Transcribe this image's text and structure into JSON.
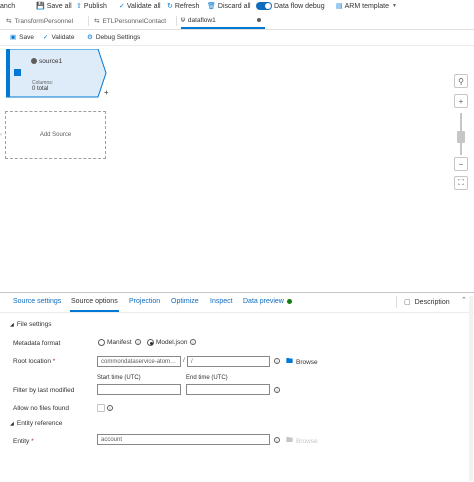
{
  "toolbar": {
    "branch_partial": "anch",
    "save_all": "Save all",
    "publish": "Publish",
    "validate_all": "Validate all",
    "refresh": "Refresh",
    "discard_all": "Discard all",
    "data_flow_debug": "Data flow debug",
    "arm_template": "ARM template"
  },
  "tabs": [
    {
      "label": "TransformPersonnel",
      "icon": "pipeline-icon"
    },
    {
      "label": "ETLPersonnelContact",
      "icon": "pipeline-icon"
    },
    {
      "label": "dataflow1",
      "icon": "dataflow-icon",
      "active": true
    }
  ],
  "subtoolbar": {
    "save": "Save",
    "validate": "Validate",
    "debug_settings": "Debug Settings"
  },
  "canvas": {
    "node": {
      "title": "source1",
      "columns_label": "Columns:",
      "columns_value": "0 total"
    },
    "add_source": "Add Source"
  },
  "panel": {
    "tabs": [
      "Source settings",
      "Source options",
      "Projection",
      "Optimize",
      "Inspect",
      "Data preview"
    ],
    "active_tab": "Source options",
    "data_preview_status_color": "#107c10",
    "description": "Description",
    "file_settings": {
      "heading": "File settings",
      "metadata_format_label": "Metadata format",
      "option_manifest": "Manifest",
      "option_model_json": "Model.json",
      "selected_option": "Model.json",
      "root_location_label": "Root location",
      "root_location_container": "commondataservice-atom…",
      "root_location_path": "/",
      "separator": "/",
      "browse": "Browse",
      "filter_label": "Filter by last modified",
      "start_time_label": "Start time (UTC)",
      "end_time_label": "End time (UTC)",
      "allow_no_files_label": "Allow no files found"
    },
    "entity_reference": {
      "heading": "Entity reference",
      "entity_label": "Entity",
      "entity_value": "account",
      "browse": "Browse"
    }
  },
  "colors": {
    "accent": "#0078d4",
    "toggle_on": "#0f6cbd",
    "required": "#a4262c"
  }
}
